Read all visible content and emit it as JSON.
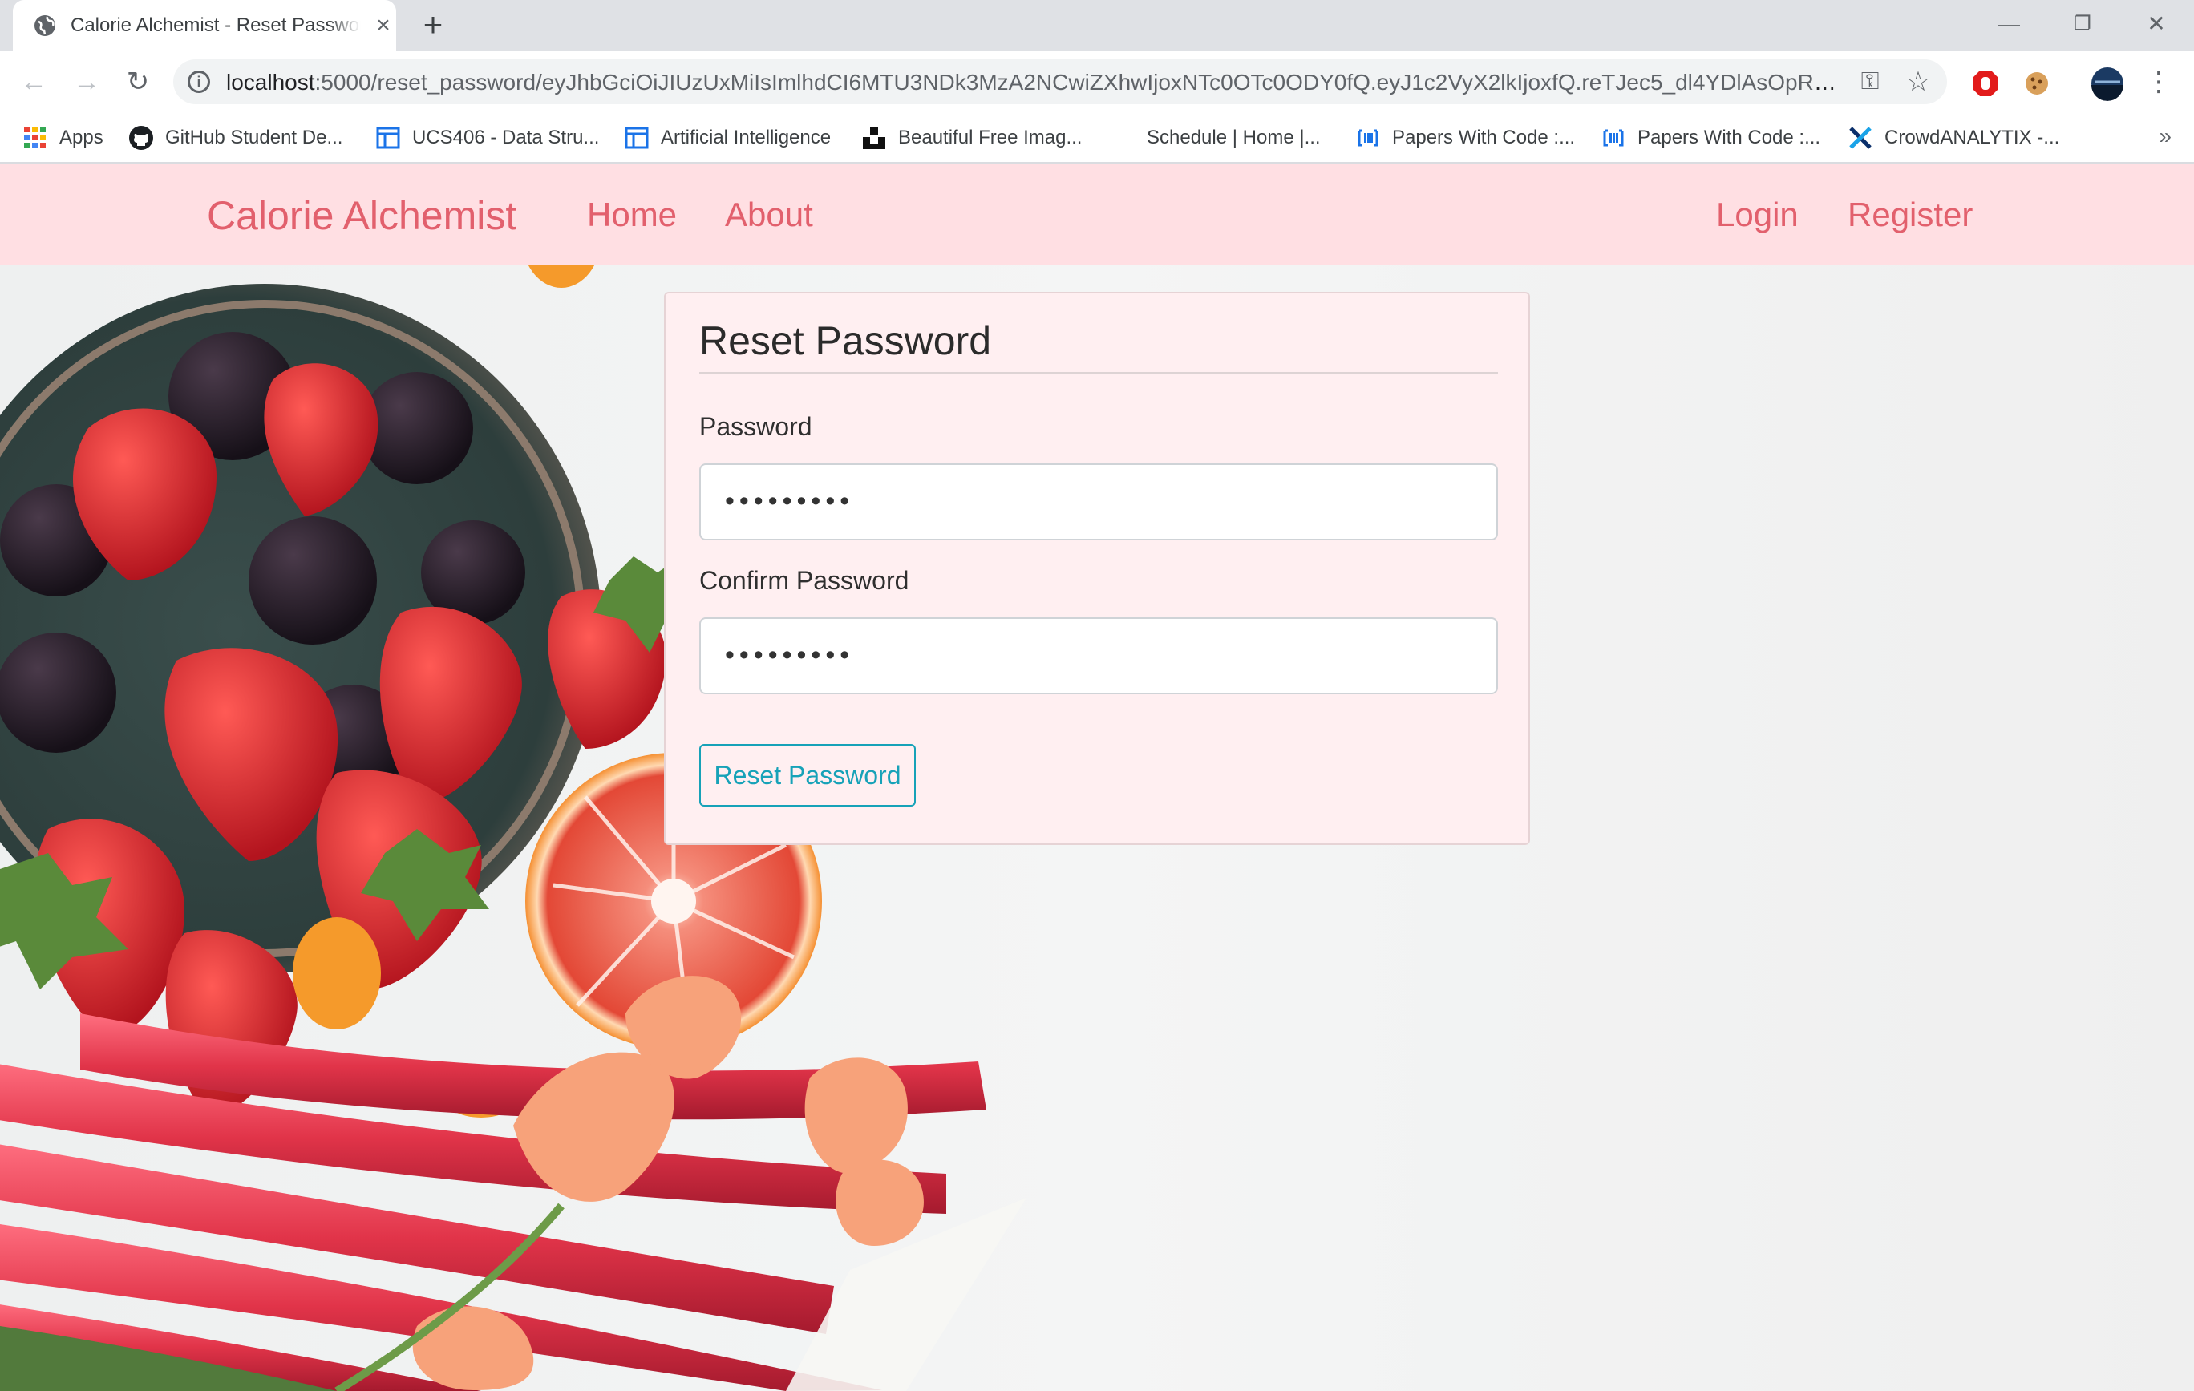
{
  "browser": {
    "tab": {
      "title": "Calorie Alchemist - Reset Password",
      "favicon": "globe-icon",
      "close": "×"
    },
    "new_tab": "+",
    "window_controls": {
      "minimize": "—",
      "restore": "❐",
      "close": "✕"
    },
    "toolbar": {
      "back": "←",
      "forward": "→",
      "reload": "↻",
      "menu": "⋮"
    },
    "address": {
      "host": "localhost",
      "rest": ":5000/reset_password/eyJhbGciOiJIUzUxMiIsImlhdCI6MTU3NDk3MzA2NCwiZXhwIjoxNTc0OTc0ODY0fQ.eyJ1c2VyX2lkIjoxfQ.reTJec5_dl4YDlAsOpR7OZ3T..."
    },
    "bookmarks": [
      {
        "label": "Apps",
        "icon": "apps-grid-icon"
      },
      {
        "label": "GitHub Student De...",
        "icon": "github-icon"
      },
      {
        "label": "UCS406 - Data Stru...",
        "icon": "page-layout-icon"
      },
      {
        "label": "Artificial Intelligence",
        "icon": "page-layout-icon"
      },
      {
        "label": "Beautiful Free Imag...",
        "icon": "unsplash-icon"
      },
      {
        "label": "Schedule | Home |...",
        "icon": "blank-icon"
      },
      {
        "label": "Papers With Code :...",
        "icon": "paperswithcode-icon"
      },
      {
        "label": "Papers With Code :...",
        "icon": "paperswithcode-icon"
      },
      {
        "label": "CrowdANALYTIX -...",
        "icon": "crowdanalytix-icon"
      }
    ],
    "bookmarks_overflow": "»"
  },
  "site": {
    "brand": "Calorie Alchemist",
    "nav": {
      "home": "Home",
      "about": "About",
      "login": "Login",
      "register": "Register"
    },
    "colors": {
      "nav_bg": "#ffdfe3",
      "nav_text": "#e2606d",
      "accent": "#17a2b8",
      "card_bg": "#ffeff1"
    }
  },
  "form": {
    "title": "Reset Password",
    "password": {
      "label": "Password",
      "value": "•••••••••"
    },
    "confirm_password": {
      "label": "Confirm Password",
      "value": "•••••••••"
    },
    "submit_label": "Reset Password"
  }
}
